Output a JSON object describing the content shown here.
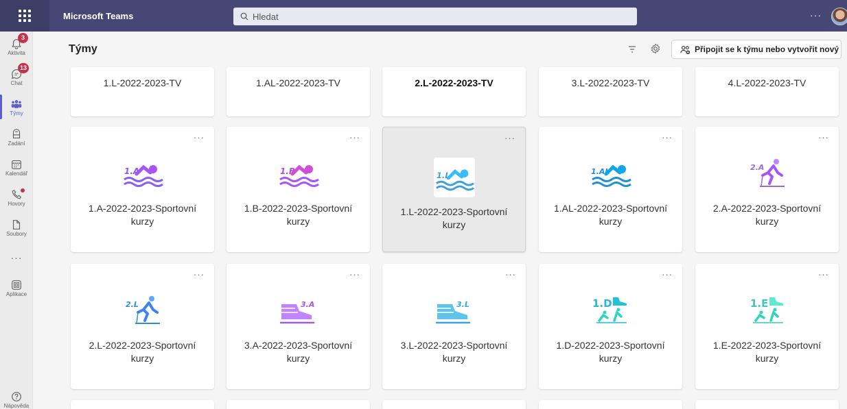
{
  "app": {
    "title": "Microsoft Teams"
  },
  "search": {
    "placeholder": "Hledat"
  },
  "topbar": {
    "more": "···"
  },
  "rail": {
    "items": [
      {
        "label": "Aktivita",
        "icon": "bell-icon",
        "badge": "3"
      },
      {
        "label": "Chat",
        "icon": "chat-icon",
        "badge": "13"
      },
      {
        "label": "Týmy",
        "icon": "teams-icon",
        "badge": ""
      },
      {
        "label": "Zadání",
        "icon": "assignments-icon",
        "badge": ""
      },
      {
        "label": "Kalendář",
        "icon": "calendar-icon",
        "badge": ""
      },
      {
        "label": "Hovory",
        "icon": "phone-icon",
        "badge": ""
      },
      {
        "label": "Soubory",
        "icon": "file-icon",
        "badge": ""
      },
      {
        "label": "Aplikace",
        "icon": "apps-icon",
        "badge": ""
      },
      {
        "label": "Nápověda",
        "icon": "help-icon",
        "badge": ""
      }
    ],
    "more": "···"
  },
  "header": {
    "title": "Týmy",
    "join_button": "Připojit se k týmu nebo vytvořit nový"
  },
  "teams": {
    "row1": [
      {
        "name": "1.L-2022-2023-TV"
      },
      {
        "name": "1.AL-2022-2023-TV"
      },
      {
        "name": "2.L-2022-2023-TV"
      },
      {
        "name": "3.L-2022-2023-TV"
      },
      {
        "name": "4.L-2022-2023-TV"
      }
    ],
    "row2": [
      {
        "line1": "1.A-2022-2023-Sportovní",
        "line2": "kurzy",
        "icon_text": "1.A",
        "icon": "swimmer-icon",
        "color": "#8b5cf6"
      },
      {
        "line1": "1.B-2022-2023-Sportovní",
        "line2": "kurzy",
        "icon_text": "1.B",
        "icon": "swimmer-icon",
        "color": "#b14fd8"
      },
      {
        "line1": "1.L-2022-2023-Sportovní",
        "line2": "kurzy",
        "icon_text": "1.L",
        "icon": "swimmer-icon",
        "color": "#3aa0e0"
      },
      {
        "line1": "1.AL-2022-2023-Sportovní",
        "line2": "kurzy",
        "icon_text": "1.AL",
        "icon": "swimmer-icon",
        "color": "#1f8fd6"
      },
      {
        "line1": "2.A-2022-2023-Sportovní",
        "line2": "kurzy",
        "icon_text": "2.A",
        "icon": "skier-icon",
        "color": "#9b6ad9"
      }
    ],
    "row3": [
      {
        "line1": "2.L-2022-2023-Sportovní",
        "line2": "kurzy",
        "icon_text": "2.L",
        "icon": "skier-icon",
        "color": "#2f8fd8"
      },
      {
        "line1": "3.A-2022-2023-Sportovní",
        "line2": "kurzy",
        "icon_text": "3.A",
        "icon": "skate-shoe-icon",
        "color": "#a45bd8"
      },
      {
        "line1": "3.L-2022-2023-Sportovní",
        "line2": "kurzy",
        "icon_text": "3.L",
        "icon": "skate-shoe-icon",
        "color": "#39a5d8"
      },
      {
        "line1": "1.D-2022-2023-Sportovní",
        "line2": "kurzy",
        "icon_text": "1.D",
        "icon": "skate-ski-icon",
        "color": "#28b8d6"
      },
      {
        "line1": "1.E-2022-2023-Sportovní",
        "line2": "kurzy",
        "icon_text": "1.E",
        "icon": "skate-ski-icon",
        "color": "#3cc7b8"
      }
    ],
    "more": "···"
  },
  "colors": {
    "topbar": "#464775",
    "accent": "#5b5fc7",
    "badge": "#c4314b"
  }
}
